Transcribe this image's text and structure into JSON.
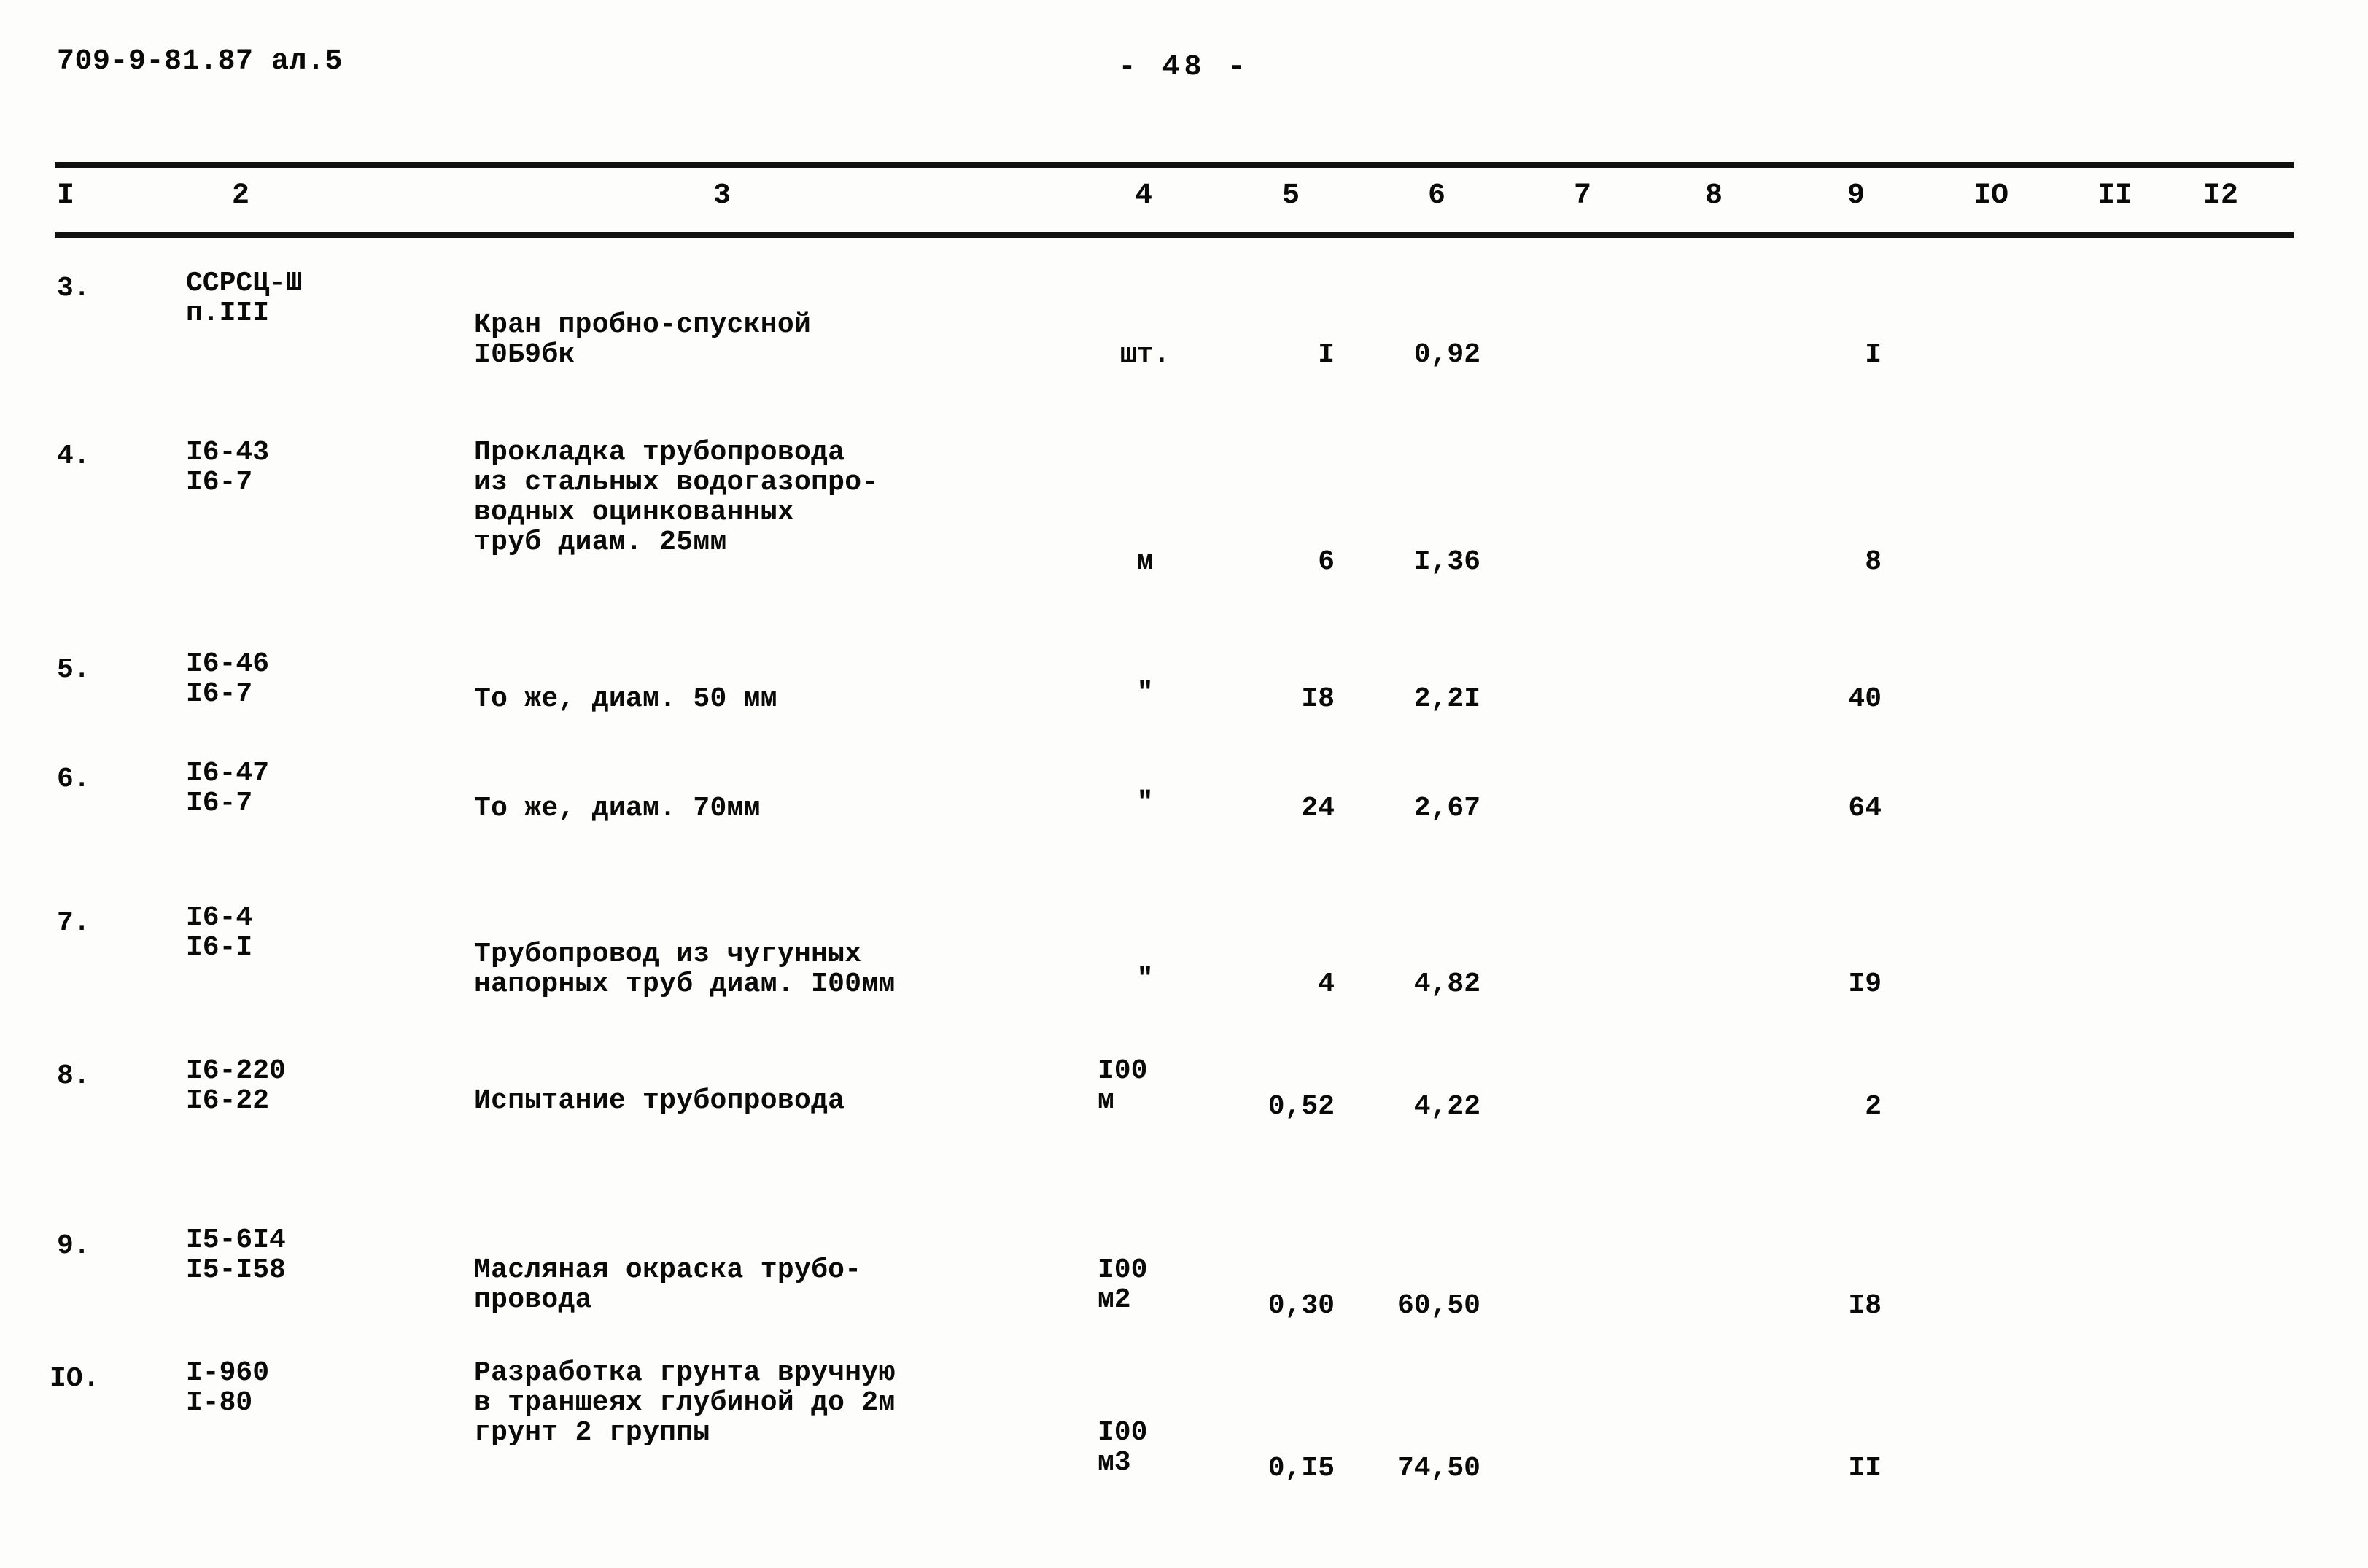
{
  "header": {
    "doc_code": "709-9-81.87 ал.5",
    "page_number": "-  48  -"
  },
  "table": {
    "column_headers": [
      "I",
      "2",
      "3",
      "4",
      "5",
      "6",
      "7",
      "8",
      "9",
      "IO",
      "II",
      "I2"
    ],
    "rows": [
      {
        "num": "3.",
        "code_line1": "ССРСЦ-Ш",
        "code_line2": "п.III",
        "name_line1": "Кран пробно-спускной",
        "name_line2": "I0Б9бк",
        "name_line3": "",
        "unit_line1": "шт.",
        "unit_line2": "",
        "qty": "I",
        "price": "0,92",
        "total": "I"
      },
      {
        "num": "4.",
        "code_line1": "I6-43",
        "code_line2": "I6-7",
        "name_line1": "Прокладка трубопровода",
        "name_line2": "из стальных водогазопро-",
        "name_line3": "водных оцинкованных",
        "name_line4": "труб диам. 25мм",
        "unit_line1": "м",
        "unit_line2": "",
        "qty": "6",
        "price": "I,36",
        "total": "8"
      },
      {
        "num": "5.",
        "code_line1": "I6-46",
        "code_line2": "I6-7",
        "name_line1": "То же, диам. 50 мм",
        "name_line2": "",
        "name_line3": "",
        "unit_line1": "\"",
        "unit_line2": "",
        "qty": "I8",
        "price": "2,2I",
        "total": "40"
      },
      {
        "num": "6.",
        "code_line1": "I6-47",
        "code_line2": "I6-7",
        "name_line1": "То же, диам. 70мм",
        "name_line2": "",
        "name_line3": "",
        "unit_line1": "\"",
        "unit_line2": "",
        "qty": "24",
        "price": "2,67",
        "total": "64"
      },
      {
        "num": "7.",
        "code_line1": "I6-4",
        "code_line2": "I6-I",
        "name_line1": "Трубопровод из чугунных",
        "name_line2": "напорных труб диам. I00мм",
        "name_line3": "",
        "unit_line1": "\"",
        "unit_line2": "",
        "qty": "4",
        "price": "4,82",
        "total": "I9"
      },
      {
        "num": "8.",
        "code_line1": "I6-220",
        "code_line2": "I6-22",
        "name_line1": "Испытание трубопровода",
        "name_line2": "",
        "name_line3": "",
        "unit_line1": "I00",
        "unit_line2": "м",
        "qty": "0,52",
        "price": "4,22",
        "total": "2"
      },
      {
        "num": "9.",
        "code_line1": "I5-6I4",
        "code_line2": "I5-I58",
        "name_line1": "Масляная окраска трубо-",
        "name_line2": "провода",
        "name_line3": "",
        "unit_line1": "I00",
        "unit_line2": "м2",
        "qty": "0,30",
        "price": "60,50",
        "total": "I8"
      },
      {
        "num": "IO.",
        "code_line1": "I-960",
        "code_line2": "I-80",
        "name_line1": "Разработка грунта вручную",
        "name_line2": "в траншеях глубиной до 2м",
        "name_line3": "грунт 2 группы",
        "unit_line1": "I00",
        "unit_line2": "м3",
        "qty": "0,I5",
        "price": "74,50",
        "total": "II"
      }
    ]
  }
}
